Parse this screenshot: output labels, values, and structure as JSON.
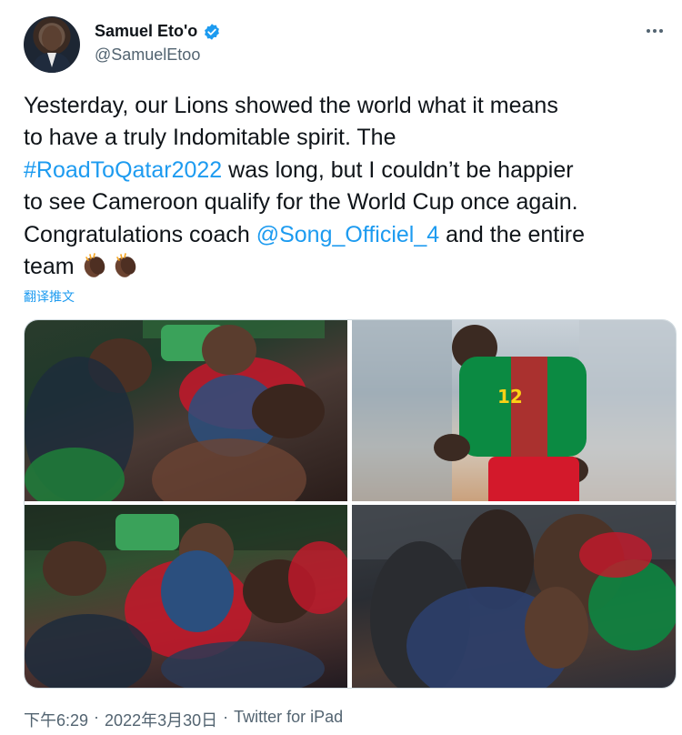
{
  "author": {
    "display_name": "Samuel Eto'o",
    "handle": "@SamuelEtoo",
    "verified": true
  },
  "tweet": {
    "text_lines": [
      {
        "parts": [
          {
            "t": "Yesterday, our Lions showed the world what it means",
            "link": false
          }
        ]
      },
      {
        "parts": [
          {
            "t": "to have a truly Indomitable spirit. The",
            "link": false
          }
        ]
      },
      {
        "parts": [
          {
            "t": "#RoadToQatar2022",
            "link": true
          },
          {
            "t": " was long, but I couldn’t be happier",
            "link": false
          }
        ]
      },
      {
        "parts": [
          {
            "t": "to see Cameroon qualify for the World Cup once again.",
            "link": false
          }
        ]
      },
      {
        "parts": [
          {
            "t": "Congratulations coach ",
            "link": false
          },
          {
            "t": "@Song_Officiel_4",
            "link": true
          },
          {
            "t": " and the entire",
            "link": false
          }
        ]
      },
      {
        "parts": [
          {
            "t": "team ",
            "link": false
          }
        ]
      }
    ],
    "emojis": [
      "clapping-hands-dark-skin",
      "clapping-hands-dark-skin"
    ],
    "translate_label": "翻译推文"
  },
  "media": {
    "photos": [
      {
        "name": "celebration-lifted-photo",
        "description_icon": "photo-icon"
      },
      {
        "name": "player-number-12-photo",
        "description_icon": "photo-icon"
      },
      {
        "name": "team-celebration-photo",
        "description_icon": "photo-icon"
      },
      {
        "name": "embrace-photo",
        "description_icon": "photo-icon"
      }
    ],
    "jersey_number": "12"
  },
  "footer": {
    "time": "下午6:29",
    "separator": "·",
    "date": "2022年3月30日",
    "source": "Twitter for iPad"
  },
  "colors": {
    "link": "#1d9bf0",
    "text": "#0f1419",
    "muted": "#536471",
    "verified": "#1d9bf0",
    "cameroon_green": "#007a3d",
    "cameroon_red": "#ce1126",
    "cameroon_yellow": "#fcd116"
  }
}
